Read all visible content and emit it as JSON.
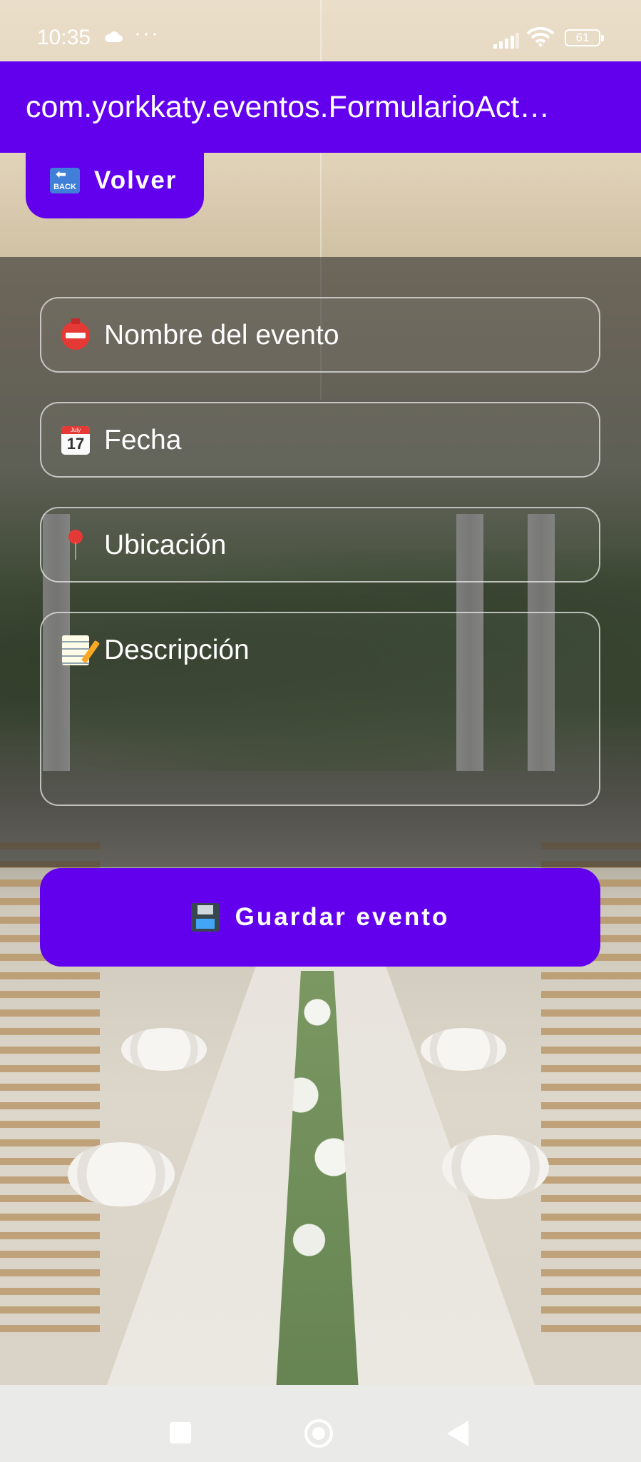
{
  "status_bar": {
    "time": "10:35",
    "dots": "···",
    "battery": "61"
  },
  "app_bar": {
    "title": "com.yorkkaty.eventos.FormularioAct…"
  },
  "back_button": {
    "label": "Volver",
    "icon_text": "BACK"
  },
  "form": {
    "fields": [
      {
        "icon": "name-badge-icon",
        "placeholder": "Nombre del evento"
      },
      {
        "icon": "calendar-icon",
        "placeholder": "Fecha",
        "icon_text": "July",
        "icon_day": "17"
      },
      {
        "icon": "location-pin-icon",
        "placeholder": "Ubicación"
      },
      {
        "icon": "memo-icon",
        "placeholder": "Descripción"
      }
    ]
  },
  "save_button": {
    "label": "Guardar evento",
    "icon": "floppy-disk-icon"
  },
  "colors": {
    "primary": "#6200ee",
    "on_primary": "#ffffff"
  }
}
